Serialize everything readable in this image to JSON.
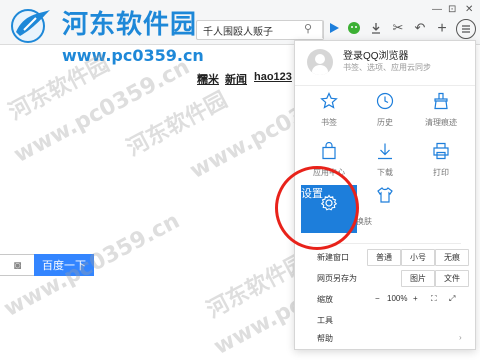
{
  "watermark": {
    "logo_text": "河东软件园",
    "url": "www.pc0359.cn",
    "diag_cn": "河东软件园",
    "diag_url": "www.pc0359.cn"
  },
  "window": {
    "minimize": "—",
    "restore": "⊡",
    "close": "✕"
  },
  "addressbar": {
    "text": "千人围殴人贩子"
  },
  "toolbar_icons": [
    "search-icon",
    "play-icon",
    "wechat-icon",
    "download-icon",
    "scissors-icon",
    "undo-icon",
    "add-icon",
    "menu-icon"
  ],
  "page": {
    "links": [
      "糯米",
      "新闻",
      "hao123"
    ],
    "search_button": "百度一下"
  },
  "menu": {
    "login_title": "登录QQ浏览器",
    "login_sub": "书签、选项、应用云同步",
    "grid": [
      {
        "label": "书签",
        "icon": "star-icon"
      },
      {
        "label": "历史",
        "icon": "clock-icon"
      },
      {
        "label": "清理痕迹",
        "icon": "broom-icon"
      },
      {
        "label": "应用中心",
        "icon": "bag-icon"
      },
      {
        "label": "下载",
        "icon": "download-icon"
      },
      {
        "label": "打印",
        "icon": "printer-icon"
      },
      {
        "label": "设置",
        "icon": "gear-icon"
      },
      {
        "label": "换肤",
        "icon": "shirt-icon"
      }
    ],
    "rows": {
      "new_window": "新建窗口",
      "mode_normal": "普通",
      "mode_small": "小号",
      "mode_trace": "无痕",
      "save_as": "网页另存为",
      "save_image": "图片",
      "save_file": "文件",
      "zoom": "缩放",
      "zoom_minus": "−",
      "zoom_value": "100%",
      "zoom_plus": "+",
      "tools": "工具",
      "help": "帮助",
      "arrow": "›"
    }
  },
  "colors": {
    "accent": "#1d7edb",
    "highlight_ring": "#e8221a",
    "search_button": "#3385ff",
    "logo": "#1e88d8"
  }
}
